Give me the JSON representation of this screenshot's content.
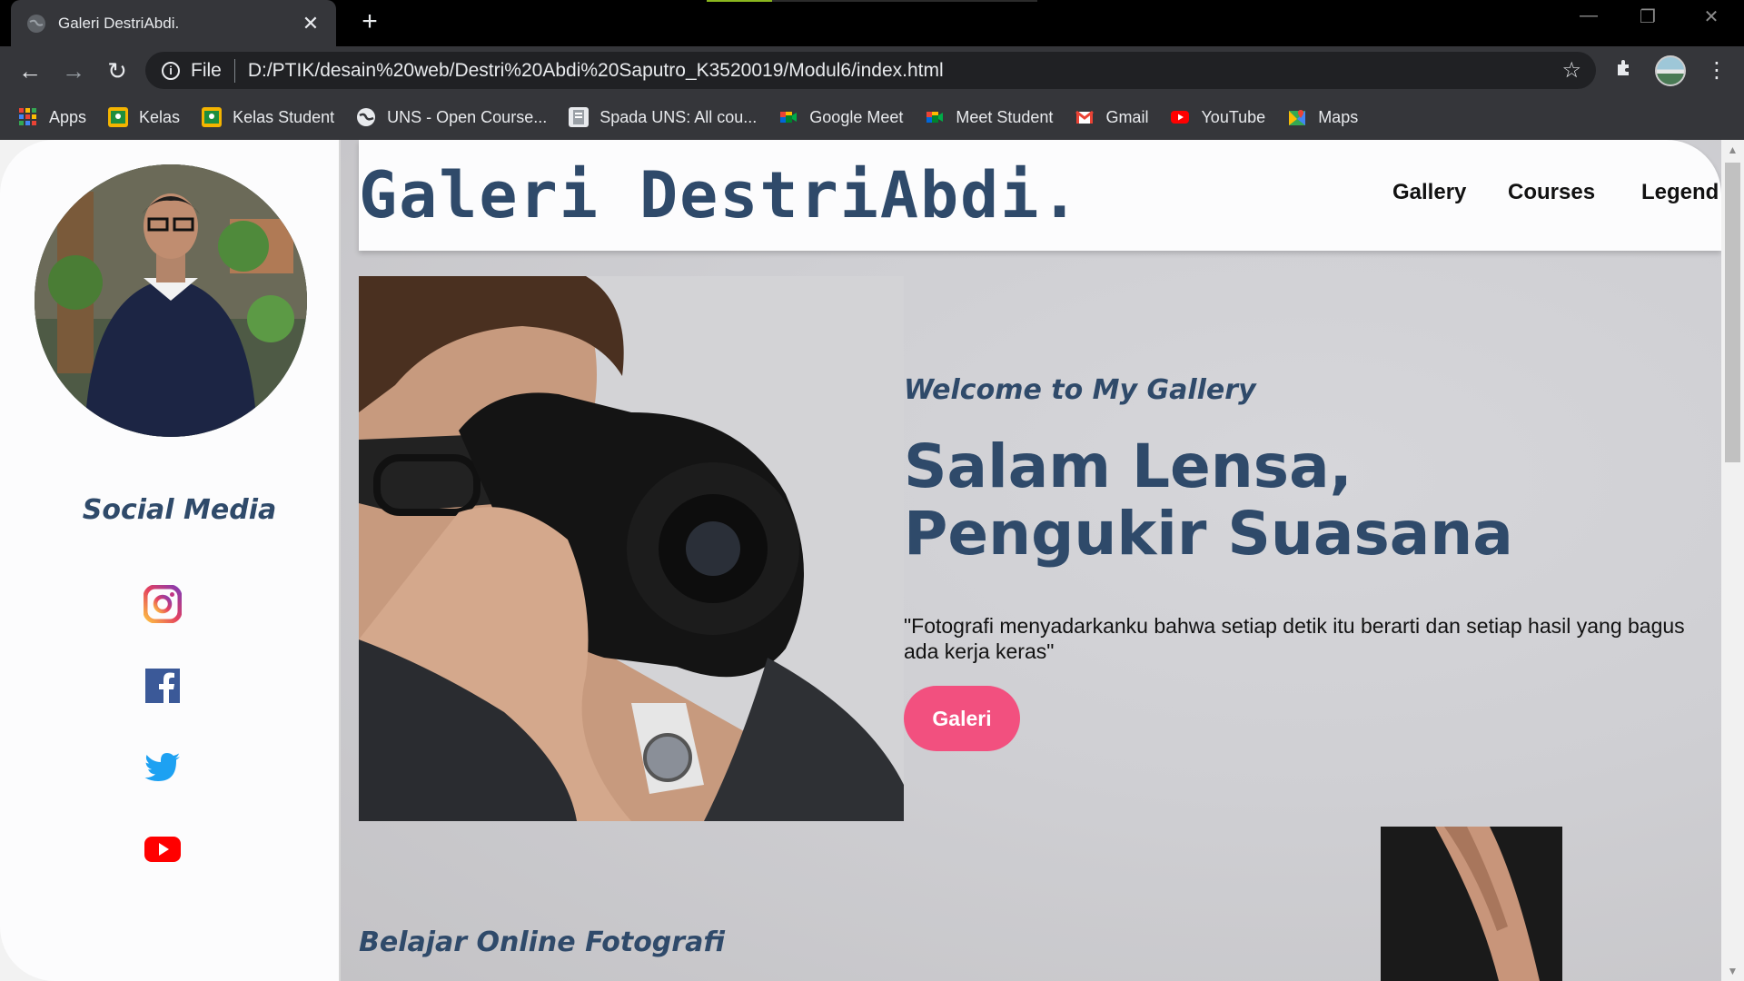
{
  "browser": {
    "tab_title": "Galeri DestriAbdi.",
    "tab_close": "✕",
    "new_tab": "+",
    "scheme_label": "File",
    "url": "D:/PTIK/desain%20web/Destri%20Abdi%20Saputro_K3520019/Modul6/index.html",
    "bookmarks": [
      {
        "label": "Apps",
        "icon": "apps-grid-icon",
        "color": "#ea4335"
      },
      {
        "label": "Kelas",
        "icon": "classroom-icon",
        "color": "#f4b400"
      },
      {
        "label": "Kelas Student",
        "icon": "classroom-icon",
        "color": "#f4b400"
      },
      {
        "label": "UNS - Open Course...",
        "icon": "globe-icon",
        "color": "#ffffff"
      },
      {
        "label": "Spada UNS: All cou...",
        "icon": "page-icon",
        "color": "#e8eaed"
      },
      {
        "label": "Google Meet",
        "icon": "meet-icon",
        "color": "#00832d"
      },
      {
        "label": "Meet Student",
        "icon": "meet-icon",
        "color": "#00832d"
      },
      {
        "label": "Gmail",
        "icon": "gmail-icon",
        "color": "#ea4335"
      },
      {
        "label": "YouTube",
        "icon": "youtube-icon",
        "color": "#ff0000"
      },
      {
        "label": "Maps",
        "icon": "maps-icon",
        "color": "#34a853"
      }
    ]
  },
  "site": {
    "brand": "Galeri DestriAbdi.",
    "nav": [
      "Gallery",
      "Courses",
      "Legend"
    ],
    "sidebar_title": "Social Media",
    "social": [
      "instagram",
      "facebook",
      "twitter",
      "youtube"
    ],
    "hero": {
      "welcome": "Welcome to My Gallery",
      "headline": "Salam Lensa, Pengukir Suasana",
      "quote": "\"Fotografi menyadarkanku bahwa setiap detik itu berarti dan setiap hasil yang bagus ada kerja keras\"",
      "button": "Galeri"
    },
    "section_title": "Belajar Online Fotografi"
  },
  "colors": {
    "accent_blue": "#2f4a6a",
    "cta_pink": "#f2507f"
  }
}
